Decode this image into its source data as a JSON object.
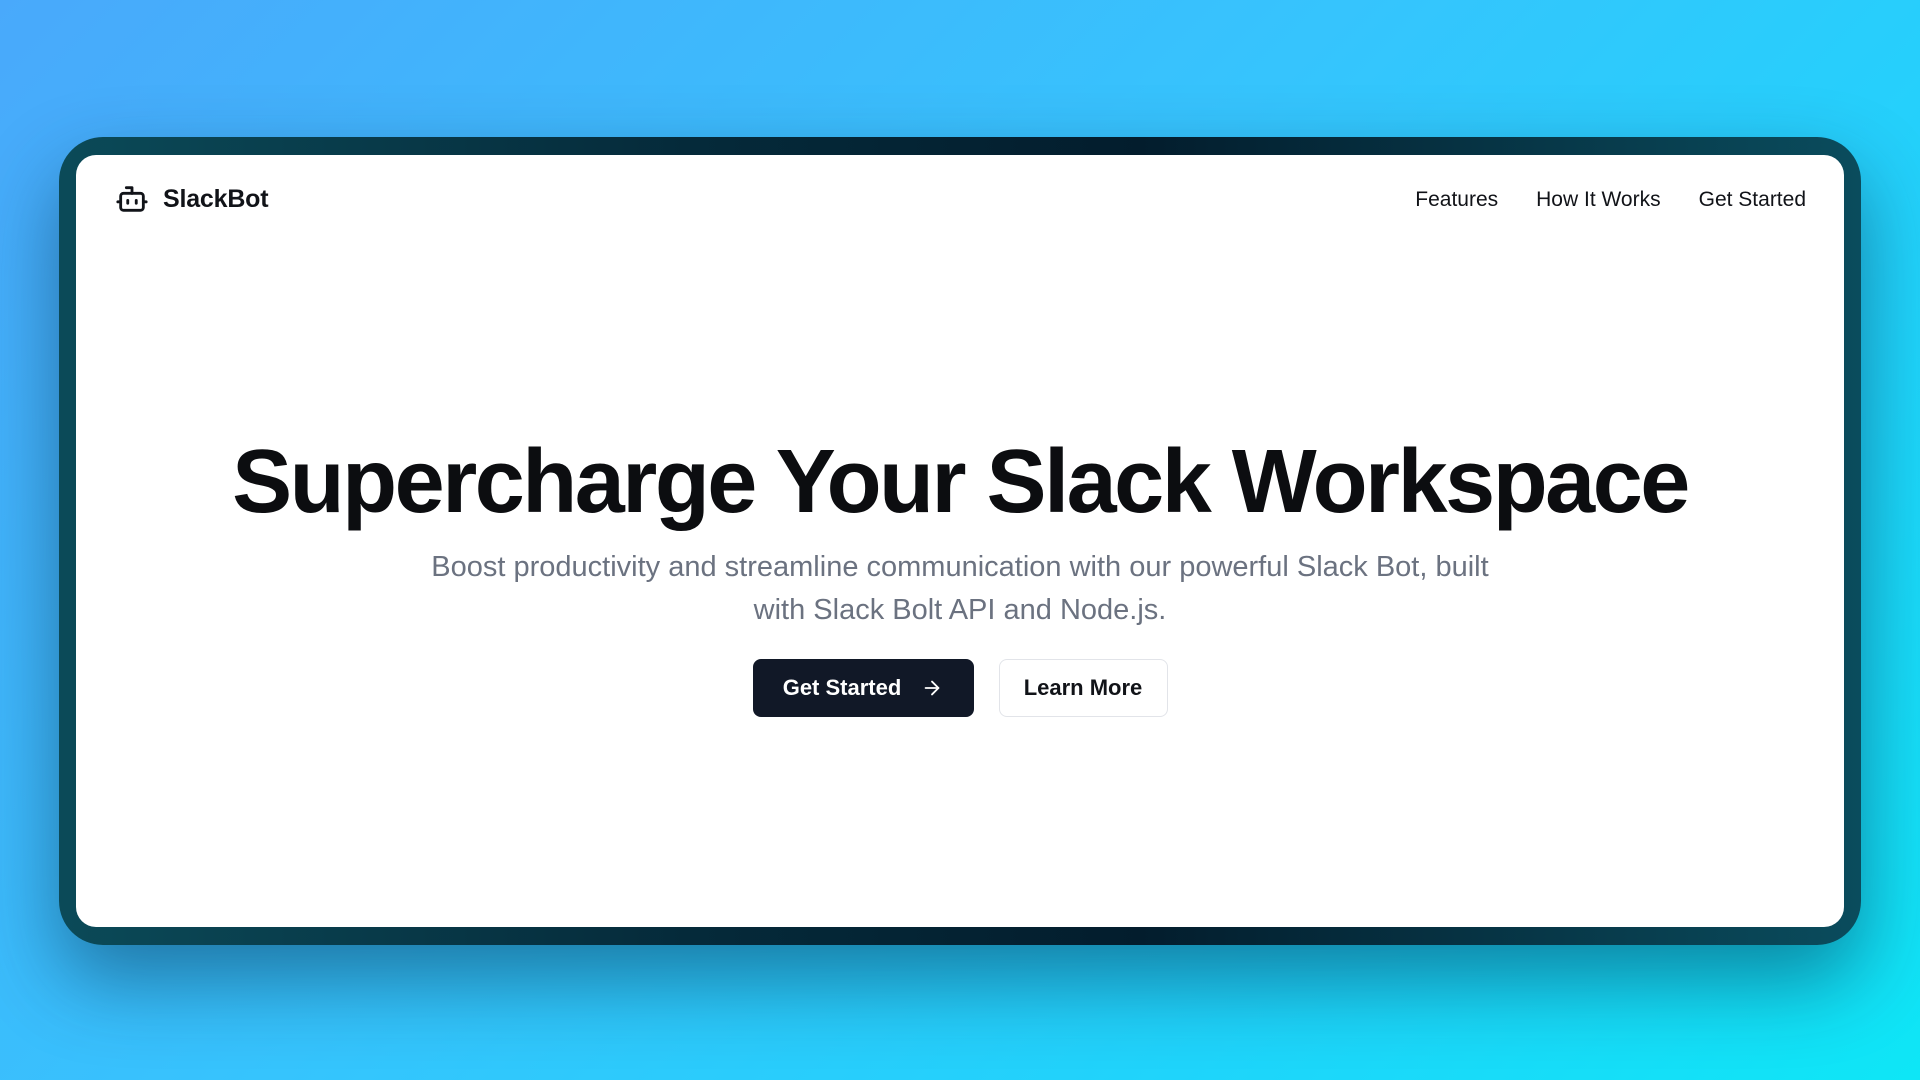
{
  "brand": {
    "name": "SlackBot",
    "icon": "bot-icon"
  },
  "nav": {
    "links": [
      "Features",
      "How It Works",
      "Get Started"
    ]
  },
  "hero": {
    "title": "Supercharge Your Slack Workspace",
    "subtitle": "Boost productivity and streamline communication with our powerful Slack Bot, built with Slack Bolt API and Node.js.",
    "primary_button": "Get Started",
    "primary_icon": "arrow-right-icon",
    "secondary_button": "Learn More"
  },
  "colors": {
    "primary_button_bg": "#111827",
    "subtitle_text": "#6b7280",
    "background_gradient_start": "#49a9fb",
    "background_gradient_end": "#0ee6f6"
  }
}
